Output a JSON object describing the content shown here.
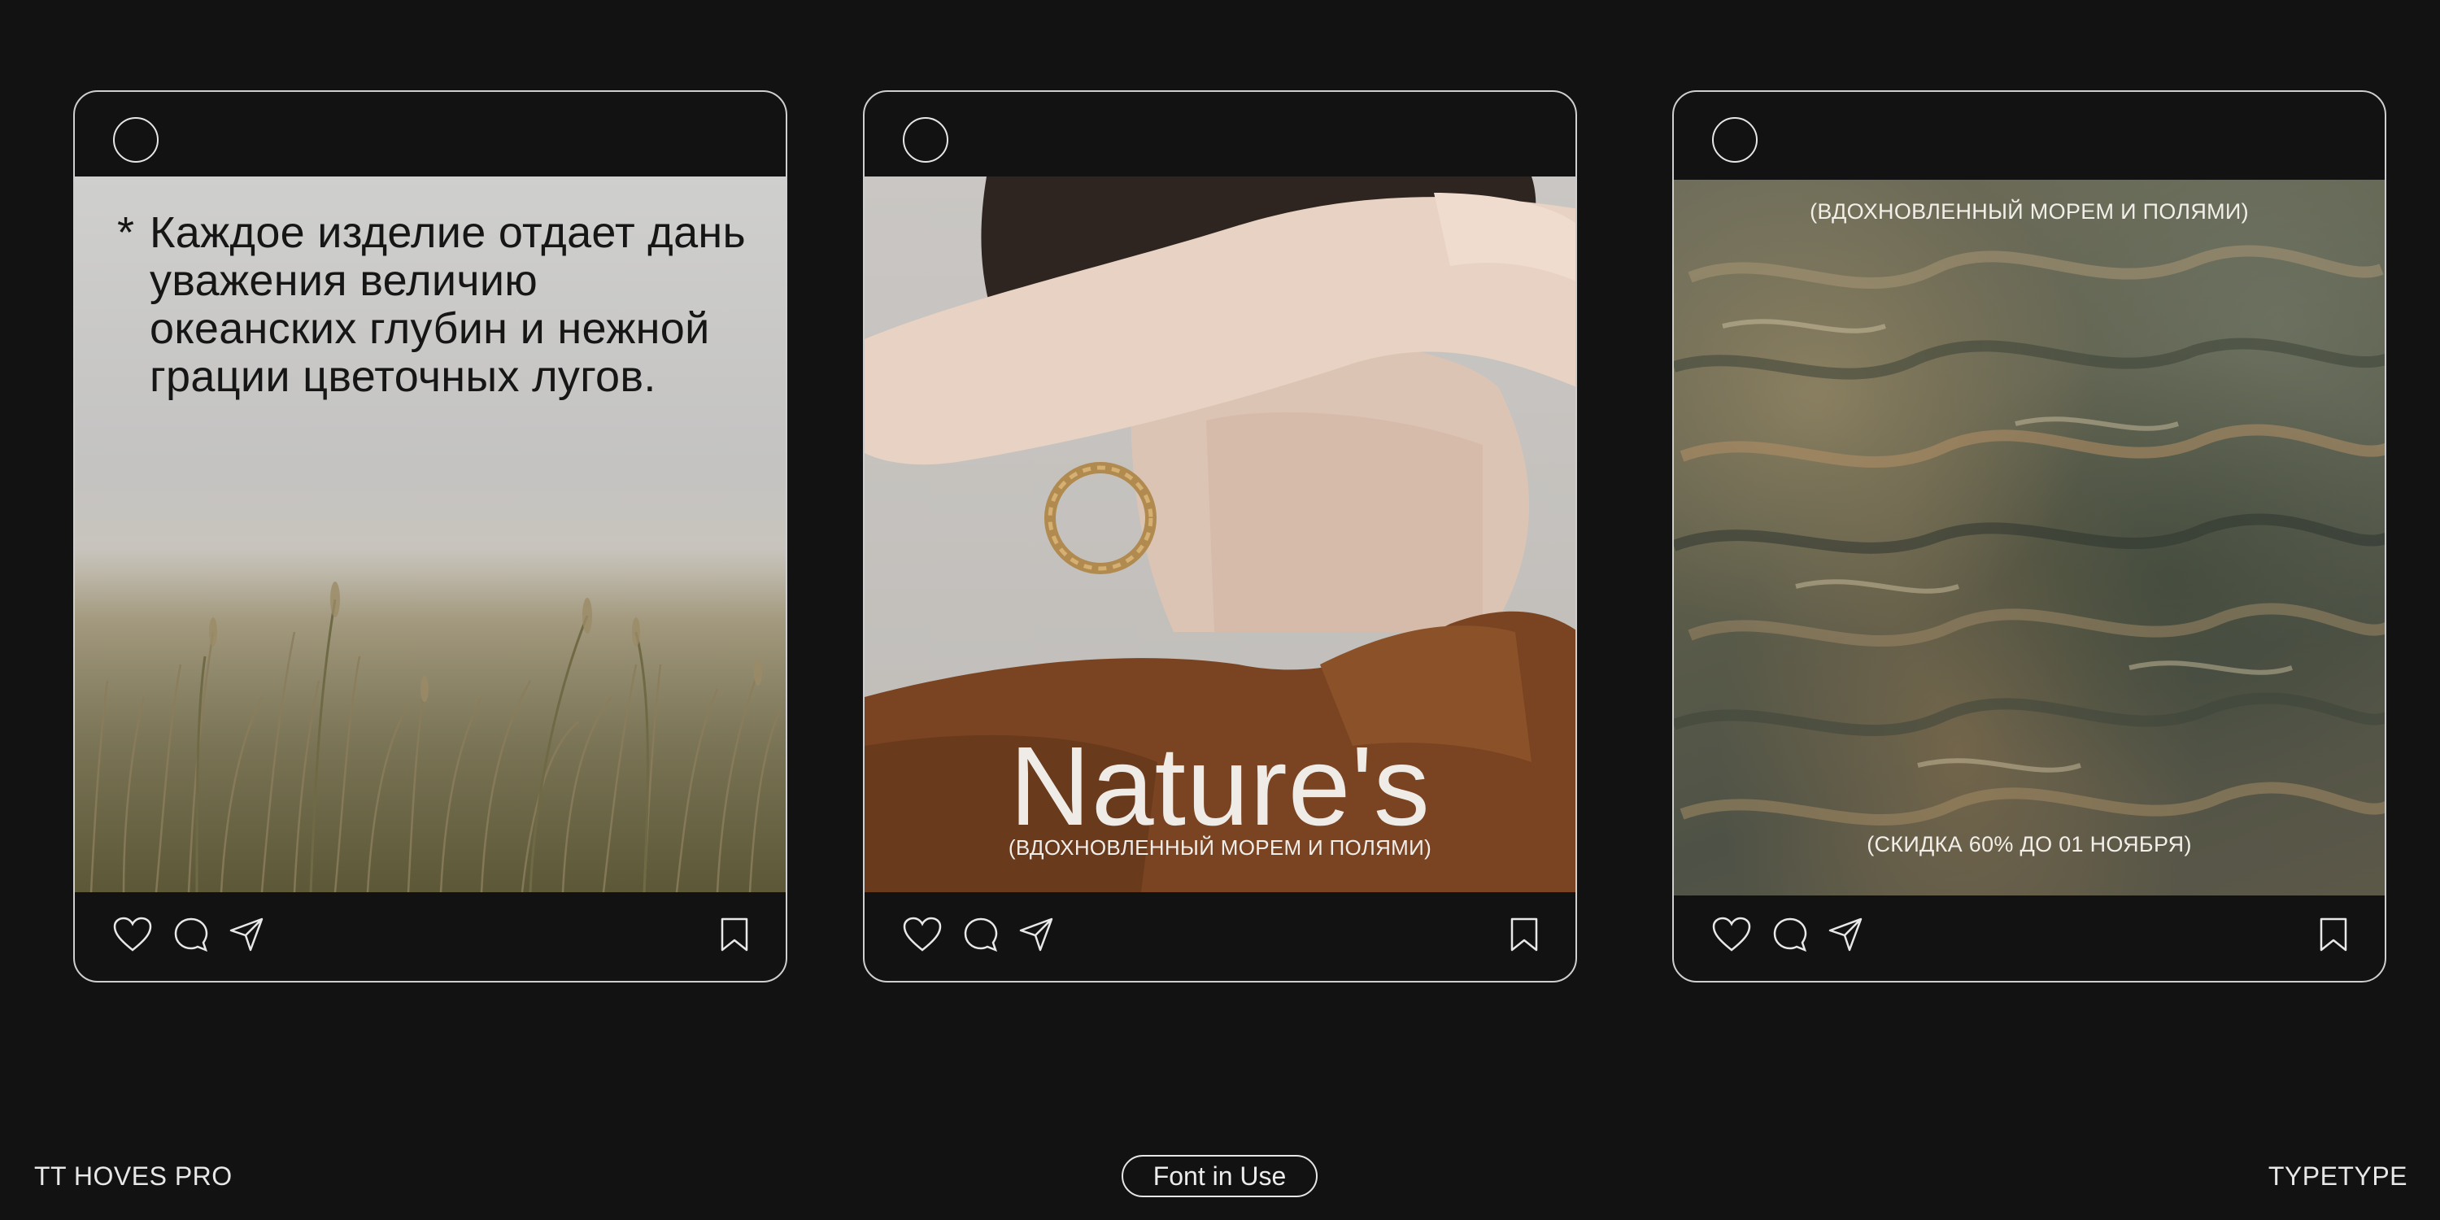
{
  "cards": [
    {
      "caption": "Каждое изделие отдает дань уважения величию океанских глубин и нежной грации цветочных лугов.",
      "caption_marker": "*",
      "photo": "meadow-grass"
    },
    {
      "title": "Nature's",
      "subtitle": "(ВДОХНОВЛЕННЫЙ МОРЕМ И ПОЛЯМИ)",
      "photo": "woman-hoop-earring"
    },
    {
      "top_text": "(ВДОХНОВЛЕННЫЙ МОРЕМ И ПОЛЯМИ)",
      "bottom_text": "(СКИДКА 60% ДО 01 НОЯБРЯ)",
      "photo": "water-surface"
    }
  ],
  "footer_icons": [
    "heart-icon",
    "comment-icon",
    "send-icon",
    "bookmark-icon"
  ],
  "bottom_bar": {
    "font_name": "TT HOVES PRO",
    "pill_label": "Font in Use",
    "brand": "TYPETYPE"
  },
  "colors": {
    "background": "#121212",
    "border": "#cfcfcf",
    "text": "#ececec",
    "shirt": "#7a4422"
  }
}
